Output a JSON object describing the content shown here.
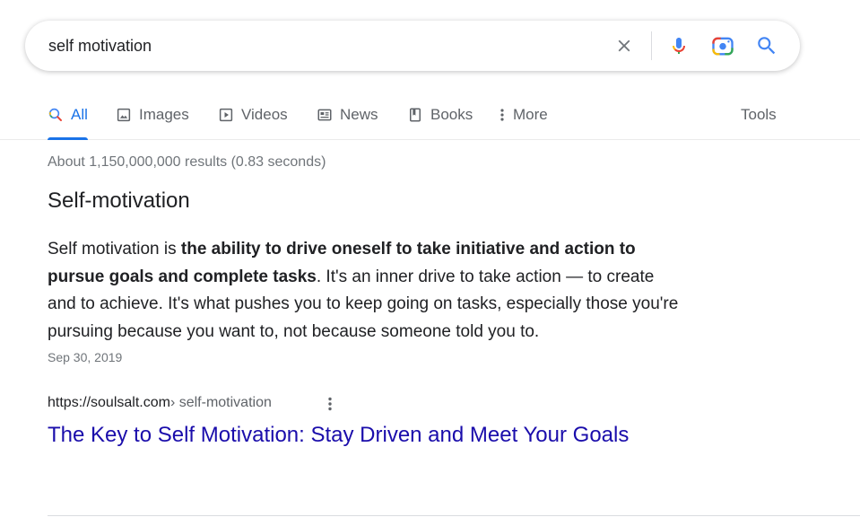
{
  "search": {
    "query": "self motivation"
  },
  "tabs": [
    {
      "label": "All",
      "icon": "search-icon",
      "active": true
    },
    {
      "label": "Images",
      "icon": "image-icon"
    },
    {
      "label": "Videos",
      "icon": "play-icon"
    },
    {
      "label": "News",
      "icon": "newspaper-icon"
    },
    {
      "label": "Books",
      "icon": "book-icon"
    },
    {
      "label": "More",
      "icon": "more-vert-icon"
    }
  ],
  "tools_label": "Tools",
  "stats": "About 1,150,000,000 results (0.83 seconds)",
  "featured_snippet": {
    "heading": "Self-motivation",
    "text_before": "Self motivation is ",
    "text_bold": "the ability to drive oneself to take initiative and action to pursue goals and complete tasks",
    "text_after": ". It's an inner drive to take action — to create and to achieve. It's what pushes you to keep going on tasks, especially those you're pursuing because you want to, not because someone told you to.",
    "date": "Sep 30, 2019"
  },
  "result": {
    "domain": "https://soulsalt.com",
    "path": " › self-motivation",
    "title": "The Key to Self Motivation: Stay Driven and Meet Your Goals"
  },
  "colors": {
    "accent": "#1a73e8",
    "link": "#1a0dab",
    "muted": "#70757a"
  }
}
